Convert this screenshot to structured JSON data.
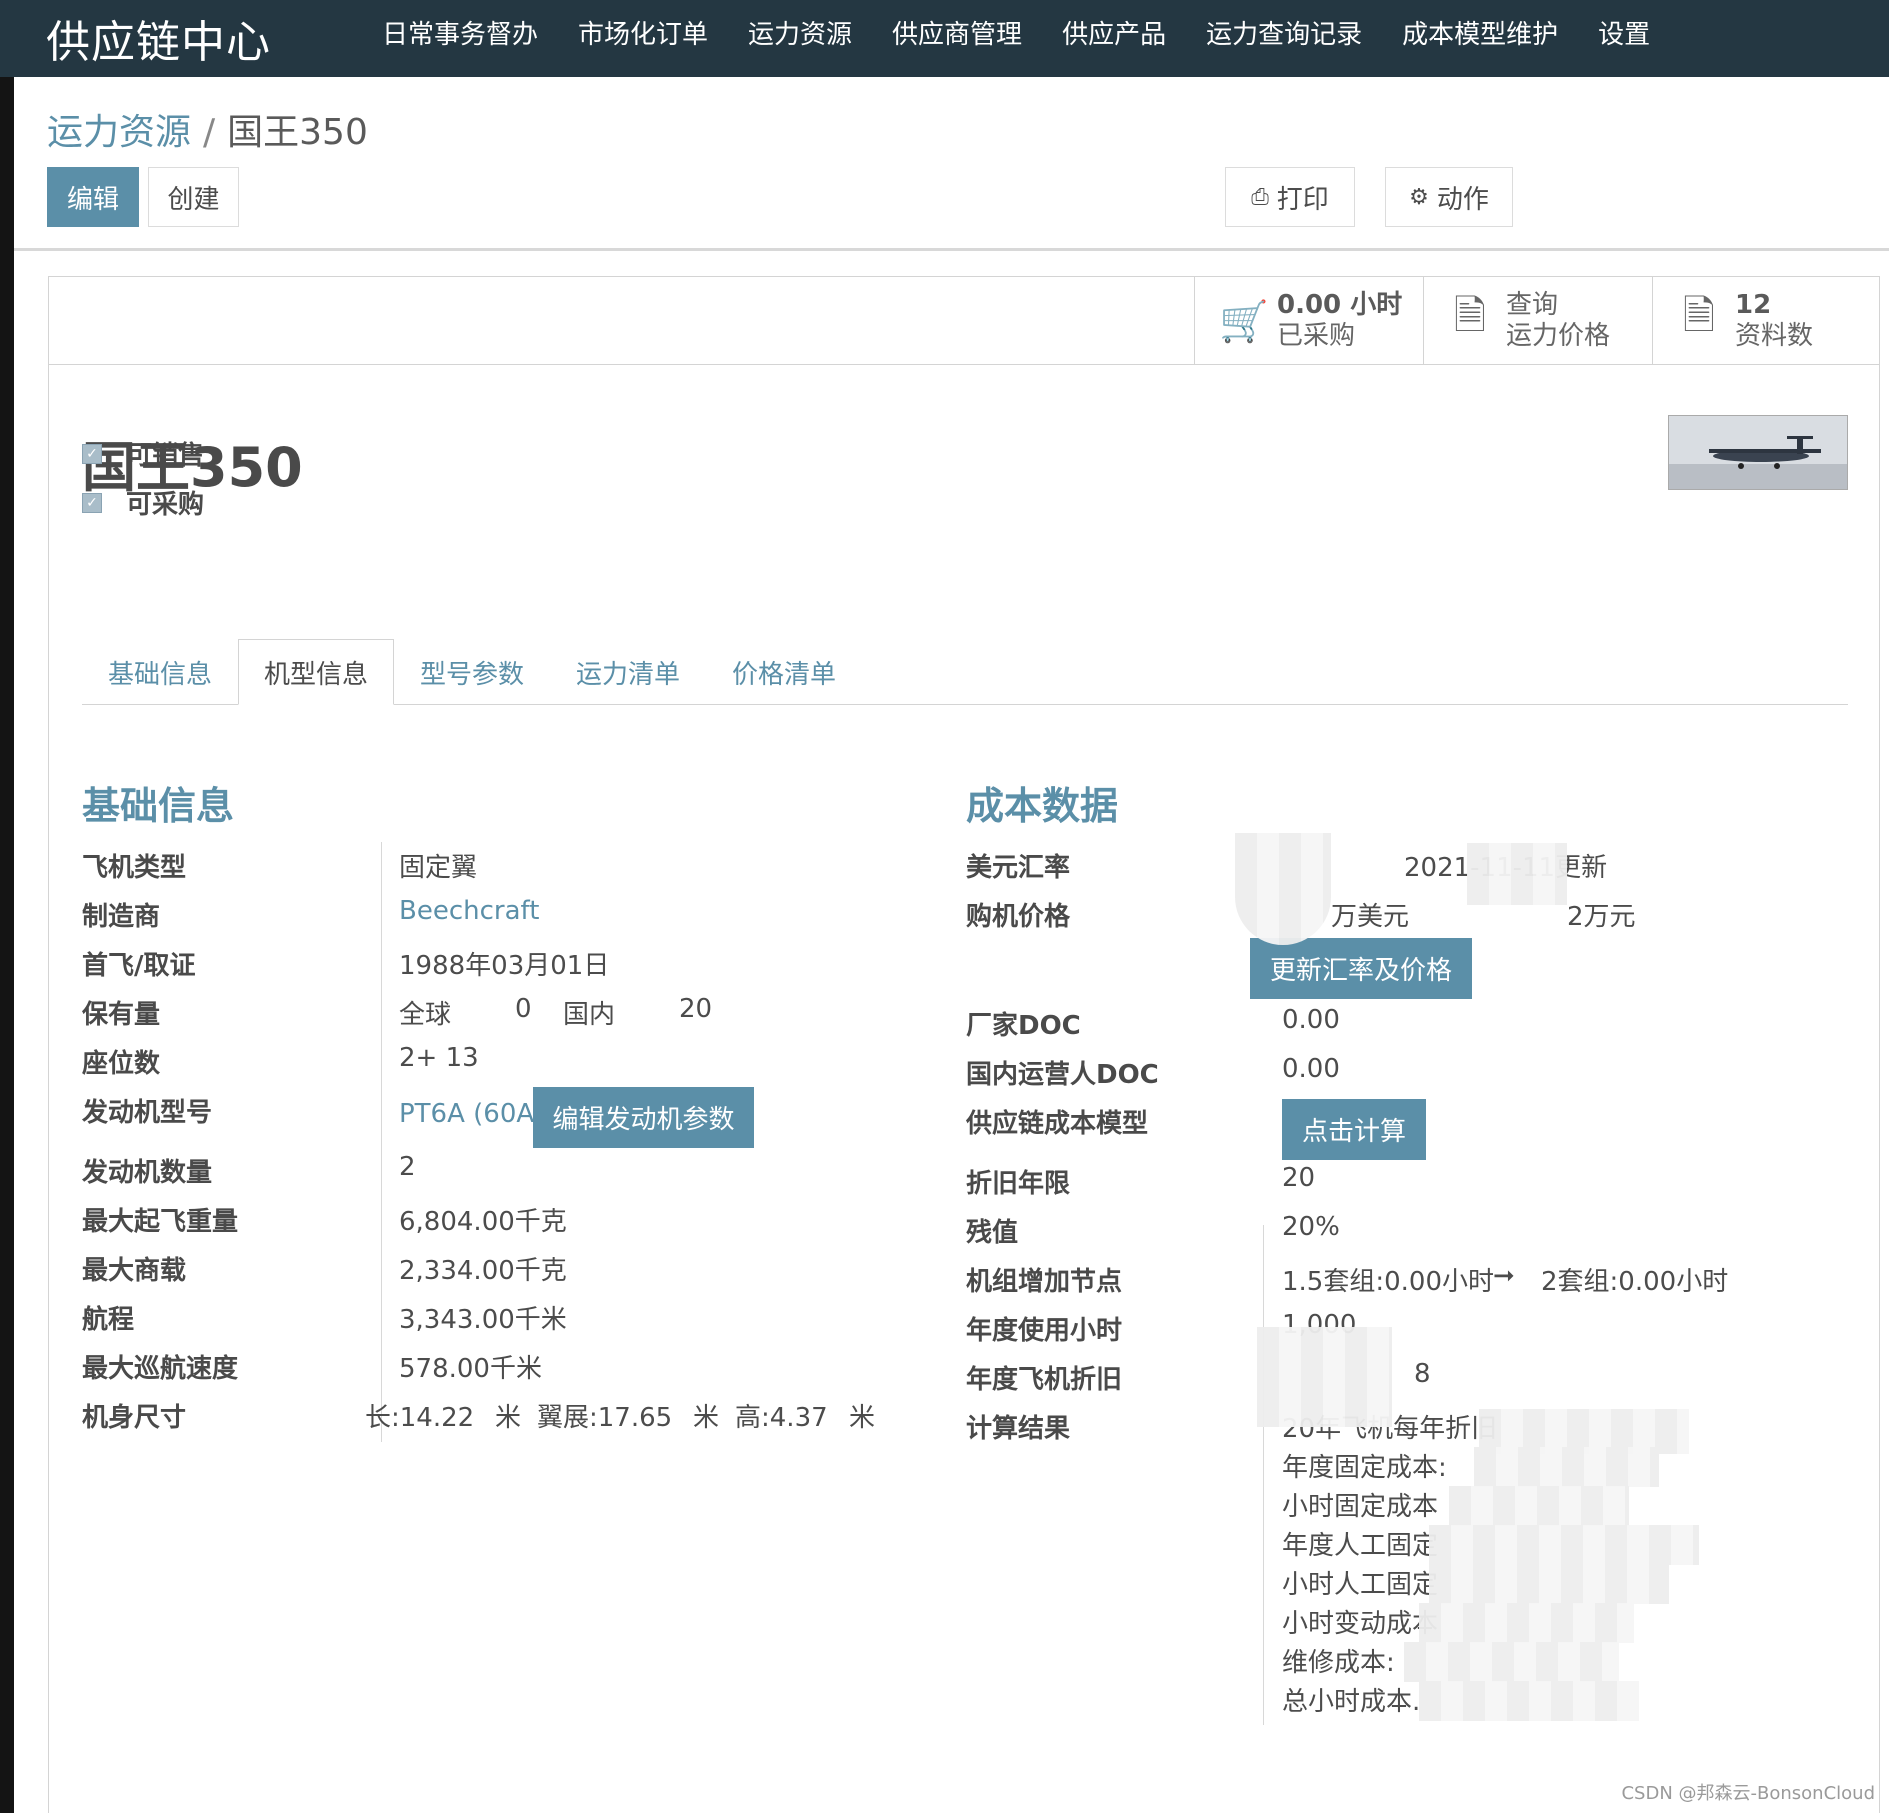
{
  "app": {
    "brand": "供应链中心"
  },
  "nav": [
    "日常事务督办",
    "市场化订单",
    "运力资源",
    "供应商管理",
    "供应产品",
    "运力查询记录",
    "成本模型维护",
    "设置"
  ],
  "breadcrumb": {
    "parent": "运力资源",
    "separator": "/",
    "current": "国王350"
  },
  "toolbar": {
    "edit": "编辑",
    "create": "创建",
    "print": "打印",
    "action": "动作"
  },
  "stats": {
    "purchased": {
      "value": "0.00 小时",
      "label": "已采购"
    },
    "query": {
      "line1": "查询",
      "line2": "运力价格"
    },
    "docs": {
      "value": "12",
      "label": "资料数"
    }
  },
  "record": {
    "title": "国王350",
    "saleable": "可销售",
    "purchasable": "可采购"
  },
  "tabs": [
    "基础信息",
    "机型信息",
    "型号参数",
    "运力清单",
    "价格清单"
  ],
  "active_tab": 1,
  "basic": {
    "heading": "基础信息",
    "fields": {
      "type_label": "飞机类型",
      "type_value": "固定翼",
      "maker_label": "制造商",
      "maker_value": "Beechcraft",
      "first_flight_label": "首飞/取证",
      "first_flight_value": "1988年03月01日",
      "fleet_label": "保有量",
      "fleet_global": "全球",
      "fleet_global_n": "0",
      "fleet_domestic": "国内",
      "fleet_domestic_n": "20",
      "seats_label": "座位数",
      "seats_value": "2+ 13",
      "engine_model_label": "发动机型号",
      "engine_model_value": "PT6A (60A)",
      "edit_engine_btn": "编辑发动机参数",
      "engine_count_label": "发动机数量",
      "engine_count_value": "2",
      "mtow_label": "最大起飞重量",
      "mtow_value": "6,804.00千克",
      "payload_label": "最大商载",
      "payload_value": "2,334.00千克",
      "range_label": "航程",
      "range_value": "3,343.00千米",
      "cruise_label": "最大巡航速度",
      "cruise_value": "578.00千米",
      "size_label": "机身尺寸",
      "size_length": "长:14.22",
      "size_wingspan": "翼展:17.65",
      "size_height": "高:4.37",
      "unit_m": "米"
    }
  },
  "cost": {
    "heading": "成本数据",
    "fx_label": "美元汇率",
    "fx_value": "2021-11-11更新",
    "price_label": "购机价格",
    "price_usd": "万美元",
    "price_cny": "2万元",
    "update_btn": "更新汇率及价格",
    "maker_doc_label": "厂家DOC",
    "maker_doc_value": "0.00",
    "domestic_doc_label": "国内运营人DOC",
    "domestic_doc_value": "0.00",
    "model_label": "供应链成本模型",
    "calc_btn": "点击计算",
    "dep_years_label": "折旧年限",
    "dep_years_value": "20",
    "residual_label": "残值",
    "residual_value": "20%",
    "crew_label": "机组增加节点",
    "crew_from": "1.5套组:0.00小时",
    "crew_arrow": "➞",
    "crew_to": "2套组:0.00小时",
    "annual_hours_label": "年度使用小时",
    "annual_hours_value": "1,000",
    "annual_dep_label": "年度飞机折旧",
    "annual_dep_value": "8",
    "result_label": "计算结果",
    "results": [
      "20年飞机每年折旧",
      "年度固定成本:",
      "小时固定成本",
      "年度人工固定",
      "小时人工固定",
      "小时变动成本",
      "维修成本:",
      "总小时成本."
    ]
  },
  "watermark": "CSDN @邦森云-BonsonCloud"
}
